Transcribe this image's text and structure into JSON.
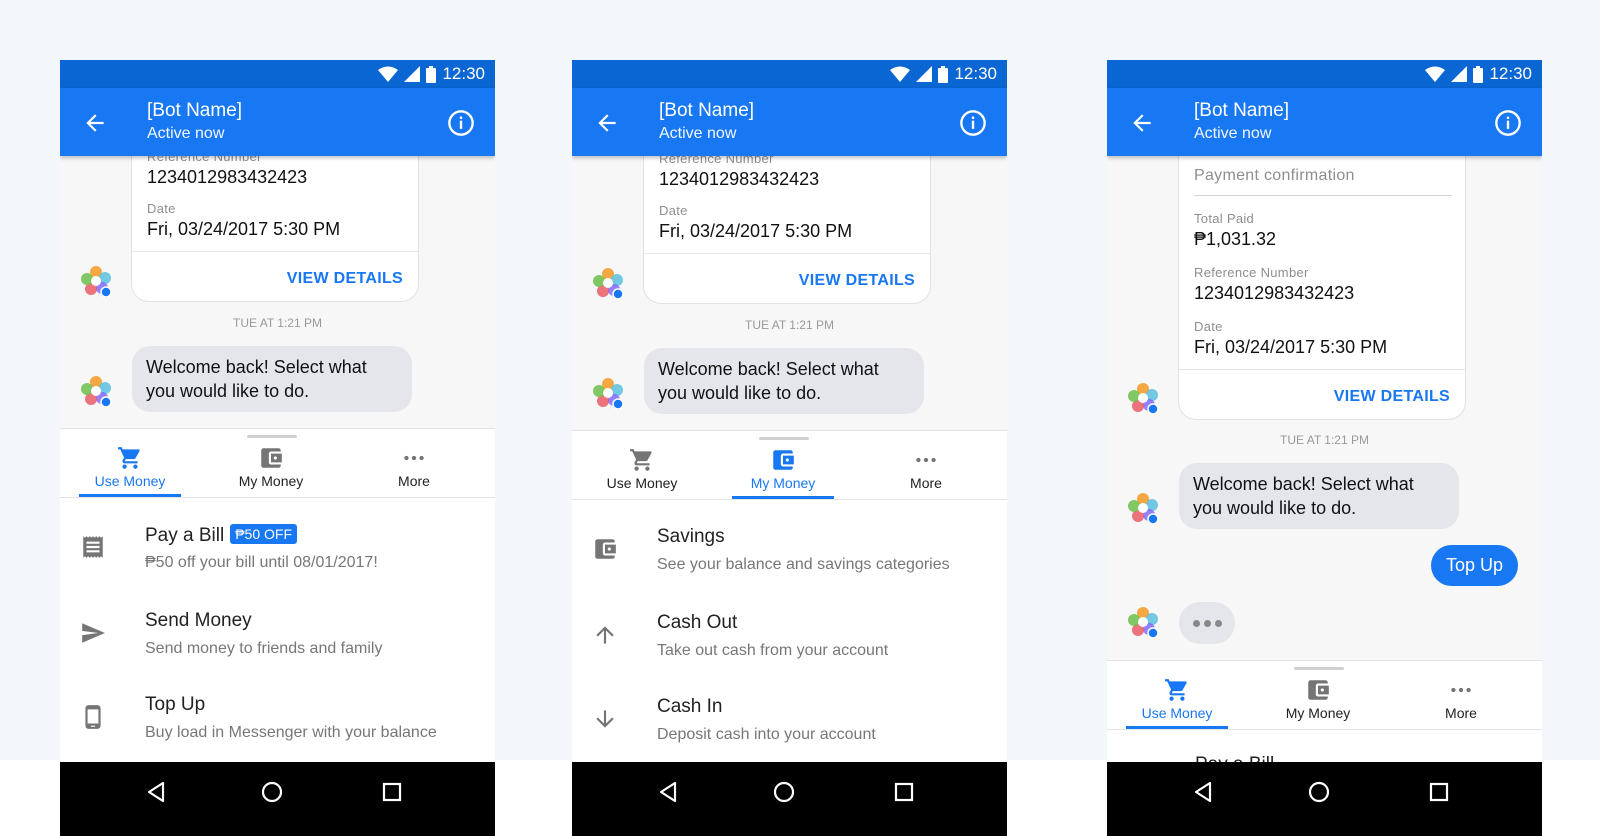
{
  "colors": {
    "primary": "#1877f2",
    "status_bar": "#0a66d2",
    "bubble_gray": "#e4e6eb",
    "background": "#f3f6fb"
  },
  "status_bar": {
    "time": "12:30"
  },
  "app_bar": {
    "title": "[Bot Name]",
    "subtitle": "Active now",
    "back_icon": "arrow-left-icon",
    "info_icon": "info-icon"
  },
  "receipt": {
    "header": "Payment confirmation",
    "total_label": "Total Paid",
    "total_value": "₱1,031.32",
    "ref_label": "Reference Number",
    "ref_value": "1234012983432423",
    "date_label": "Date",
    "date_value": "Fri, 03/24/2017 5:30 PM",
    "action": "VIEW DETAILS"
  },
  "timestamp": "TUE AT 1:21 PM",
  "bot_message": "Welcome back! Select what you would like to do.",
  "user_message": "Top Up",
  "tabs": [
    {
      "label": "Use Money",
      "icon": "cart-icon"
    },
    {
      "label": "My Money",
      "icon": "wallet-icon"
    },
    {
      "label": "More",
      "icon": "more-icon"
    }
  ],
  "use_money_items": [
    {
      "title": "Pay a Bill",
      "badge": "₱50 OFF",
      "subtitle": "₱50 off your bill until 08/01/2017!",
      "icon": "receipt-icon"
    },
    {
      "title": "Send Money",
      "subtitle": "Send money to friends and family",
      "icon": "send-icon"
    },
    {
      "title": "Top Up",
      "subtitle": "Buy load in Messenger with your balance",
      "icon": "phone-icon"
    }
  ],
  "my_money_items": [
    {
      "title": "Savings",
      "subtitle": "See your balance and savings categories",
      "icon": "wallet-icon"
    },
    {
      "title": "Cash Out",
      "subtitle": "Take out cash from your account",
      "icon": "arrow-up-icon"
    },
    {
      "title": "Cash In",
      "subtitle": "Deposit cash into your account",
      "icon": "arrow-down-icon"
    }
  ],
  "partial_item": "Pay a Bill",
  "nav_icons": [
    "back-triangle-icon",
    "home-circle-icon",
    "recents-square-icon"
  ]
}
